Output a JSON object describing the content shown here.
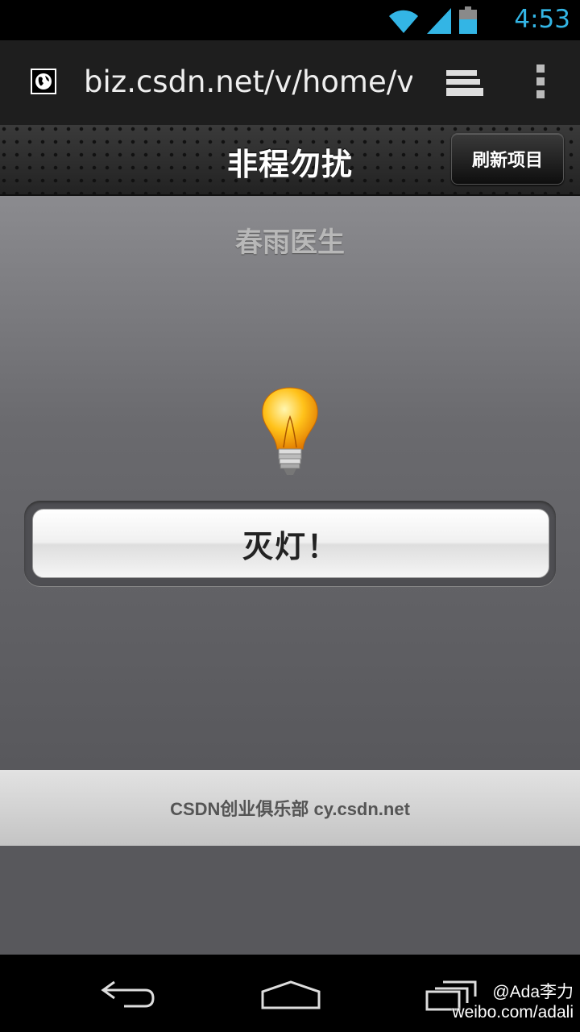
{
  "status_bar": {
    "time": "4:53",
    "icons": [
      "wifi-icon",
      "signal-icon",
      "battery-icon"
    ],
    "accent_color": "#33b5e5"
  },
  "browser": {
    "url": "biz.csdn.net/v/home/vote",
    "icons": [
      "globe-icon",
      "tabs-icon",
      "overflow-menu-icon"
    ]
  },
  "header": {
    "title": "非程勿扰",
    "refresh_label": "刷新项目"
  },
  "main": {
    "subtitle": "春雨医生",
    "bulb_icon": "lightbulb-icon",
    "action_label": "灭灯！"
  },
  "footer": {
    "text": "CSDN创业俱乐部 cy.csdn.net"
  },
  "nav_bar": {
    "icons": [
      "back-icon",
      "home-icon",
      "recents-icon"
    ]
  },
  "watermark": {
    "handle": "@Ada李力",
    "site": "weibo.com/adali"
  }
}
